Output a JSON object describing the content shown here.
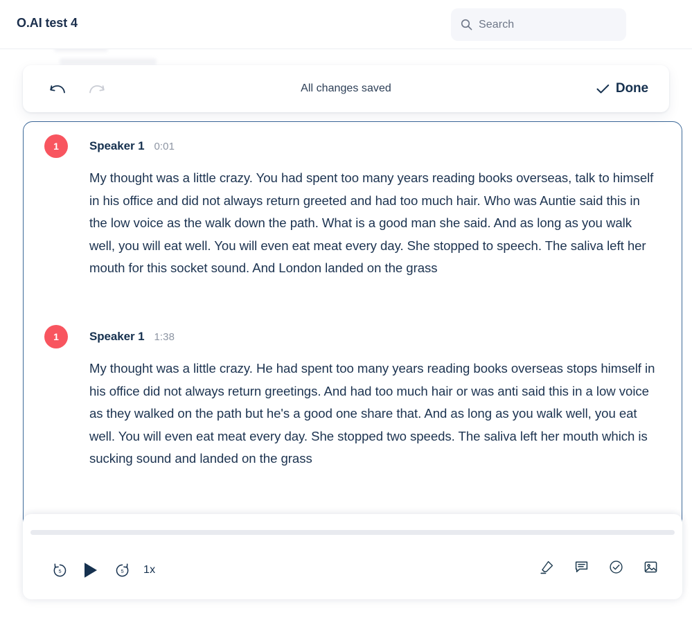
{
  "header": {
    "title": "O.AI test 4",
    "search": {
      "placeholder": "Search",
      "value": "",
      "icon": "search-icon"
    }
  },
  "toolbar": {
    "undo_icon": "undo-arrow-icon",
    "undo_label": "Undo",
    "redo_icon": "redo-arrow-icon",
    "redo_label": "Redo",
    "redo_disabled": true,
    "status": "All changes saved",
    "done_label": "Done",
    "done_icon": "check-icon"
  },
  "transcript": {
    "segments": [
      {
        "badge": "1",
        "speaker": "Speaker 1",
        "time": "0:01",
        "text": "My thought was a little crazy. You had spent too many years reading books overseas, talk to himself in his office and did not always return greeted and had too much hair. Who was Auntie said this in the low voice as the walk down the path. What is a good man she said. And as long as you walk well, you will eat well. You will even eat meat every day. She stopped to speech. The saliva left her mouth for this socket sound. And London landed on the grass"
      },
      {
        "badge": "1",
        "speaker": "Speaker 1",
        "time": "1:38",
        "text": "My thought was a little crazy. He had spent too many years reading books overseas stops himself in his office did not always return greetings. And had too much hair or was anti said this in a low voice as they walked on the path but he's a good one share that. And as long as you walk well, you eat well. You will even eat meat every day. She stopped two speeds. The saliva left her mouth which is sucking sound and landed on the grass"
      }
    ]
  },
  "player": {
    "progress_percent": 0,
    "rewind_label": "5",
    "rewind_icon": "rewind-5-icon",
    "play_icon": "play-icon",
    "play_label": "Play",
    "forward_label": "5",
    "forward_icon": "forward-5-icon",
    "speed": "1x",
    "actions": [
      {
        "icon": "highlighter-icon",
        "label": "Highlight"
      },
      {
        "icon": "comment-icon",
        "label": "Comment"
      },
      {
        "icon": "check-circle-icon",
        "label": "Mark done"
      },
      {
        "icon": "image-icon",
        "label": "Insert image"
      }
    ]
  },
  "colors": {
    "accent_border": "#3c6898",
    "speaker_badge": "#f8555f",
    "text": "#16314f",
    "muted": "#8d95a3",
    "track": "#e8eaef"
  }
}
